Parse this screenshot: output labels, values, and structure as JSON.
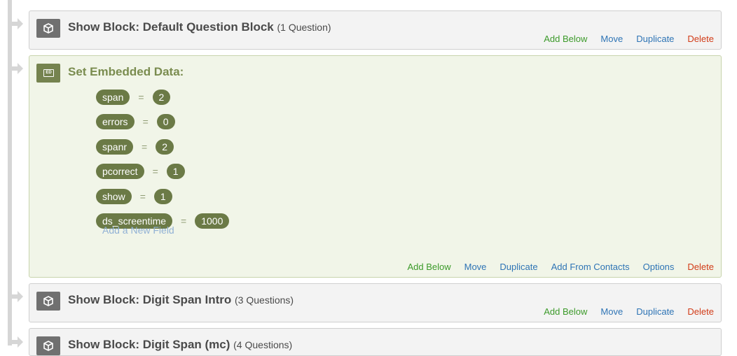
{
  "blocks": [
    {
      "title": "Show Block: Default Question Block",
      "count": "(1 Question)",
      "actions": [
        "Add Below",
        "Move",
        "Duplicate",
        "Delete"
      ]
    },
    {
      "title": "Set Embedded Data:",
      "icon_text": "ED",
      "fields": [
        {
          "name": "span",
          "eq": "=",
          "value": "2"
        },
        {
          "name": "errors",
          "eq": "=",
          "value": "0"
        },
        {
          "name": "spanr",
          "eq": "=",
          "value": "2"
        },
        {
          "name": "pcorrect",
          "eq": "=",
          "value": "1"
        },
        {
          "name": "show",
          "eq": "=",
          "value": "1"
        },
        {
          "name": "ds_screentime",
          "eq": "=",
          "value": "1000"
        }
      ],
      "add_field": "Add a New Field",
      "actions": [
        "Add Below",
        "Move",
        "Duplicate",
        "Add From Contacts",
        "Options",
        "Delete"
      ]
    },
    {
      "title": "Show Block: Digit Span Intro",
      "count": "(3 Questions)",
      "actions": [
        "Add Below",
        "Move",
        "Duplicate",
        "Delete"
      ]
    },
    {
      "title": "Show Block: Digit Span (mc)",
      "count": "(4 Questions)"
    }
  ],
  "colors": {
    "add": "#3c9a2a",
    "link": "#2e74b5",
    "delete": "#d23b17",
    "embedded_pill": "#6b7a46",
    "embedded_bg": "#f1f5e8"
  }
}
